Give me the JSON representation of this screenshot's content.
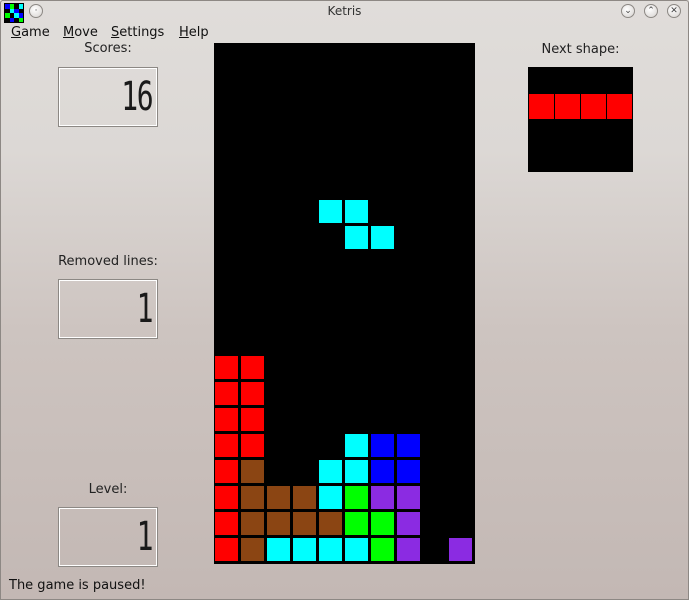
{
  "window": {
    "title": "Ketris"
  },
  "menu": [
    {
      "label": "Game",
      "mnemonic": "G",
      "rest": "ame"
    },
    {
      "label": "Move",
      "mnemonic": "M",
      "rest": "ove"
    },
    {
      "label": "Settings",
      "mnemonic": "S",
      "rest": "ettings"
    },
    {
      "label": "Help",
      "mnemonic": "H",
      "rest": "elp"
    }
  ],
  "scores": {
    "label": "Scores:",
    "value": "16"
  },
  "removed_lines": {
    "label": "Removed lines:",
    "value": "1"
  },
  "level": {
    "label": "Level:",
    "value": "1"
  },
  "next_shape": {
    "label": "Next shape:",
    "color": "#ff0000",
    "cells": [
      [
        0,
        1
      ],
      [
        1,
        1
      ],
      [
        2,
        1
      ],
      [
        3,
        1
      ]
    ],
    "grid_size": 4
  },
  "status": "The game is paused!",
  "colors": {
    "R": "#ff0000",
    "B": "#8b4513",
    "C": "#00ffff",
    "U": "#0000ff",
    "G": "#00ff00",
    "P": "#8b2be2"
  },
  "board": {
    "cols": 10,
    "rows": 20,
    "falling_piece": {
      "color": "C",
      "cells": [
        [
          4,
          6
        ],
        [
          5,
          6
        ],
        [
          5,
          7
        ],
        [
          6,
          7
        ]
      ]
    },
    "grid": [
      "..........",
      "..........",
      "..........",
      "..........",
      "..........",
      "..........",
      "..........",
      "..........",
      "..........",
      "..........",
      "..........",
      "..........",
      "RR........",
      "RR........",
      "RR........",
      "RR...CUU..",
      "RB..CCUU..",
      "RBBBCGPP..",
      "RBBBBGGP..",
      "RBCCCCGP.P"
    ]
  }
}
